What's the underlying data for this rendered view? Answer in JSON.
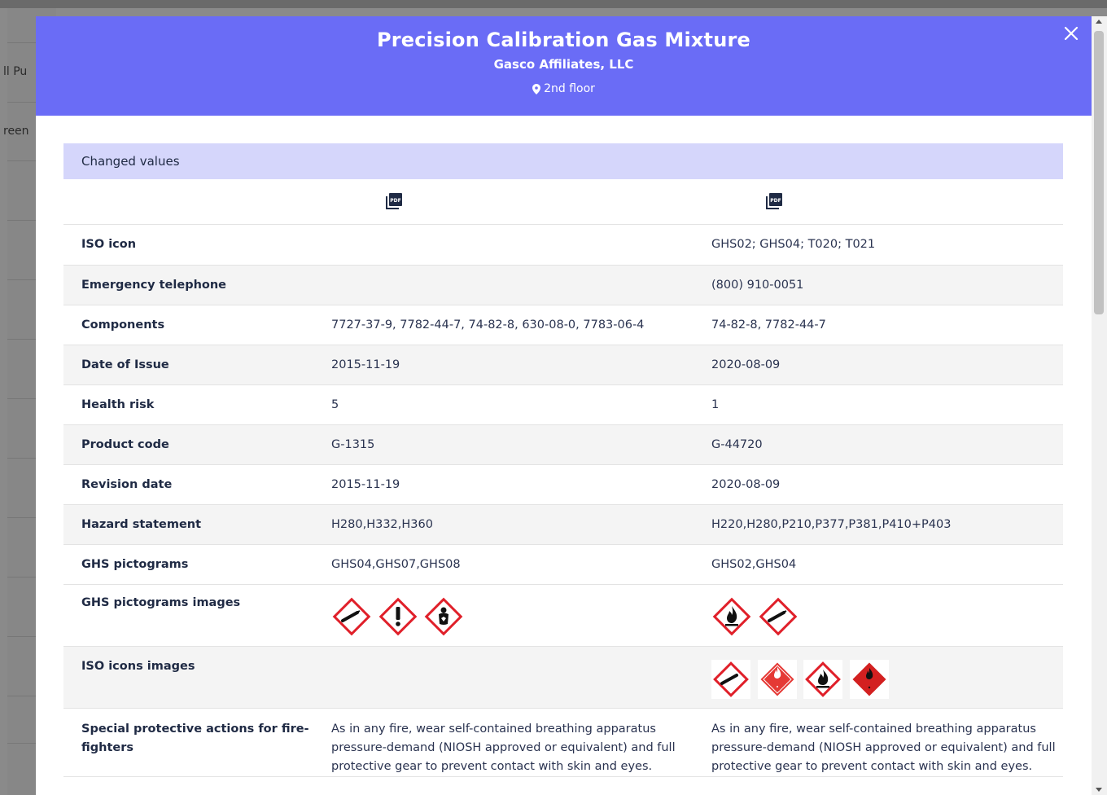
{
  "background": {
    "items": [
      "ll Pu",
      "reen"
    ]
  },
  "header": {
    "title": "Precision Calibration Gas Mixture",
    "supplier": "Gasco Affiliates, LLC",
    "location": "2nd floor"
  },
  "section_title": "Changed values",
  "rows": [
    {
      "label": "ISO icon",
      "old": "",
      "new": "GHS02; GHS04; T020; T021"
    },
    {
      "label": "Emergency telephone",
      "old": "",
      "new": "(800) 910-0051"
    },
    {
      "label": "Components",
      "old": "7727-37-9, 7782-44-7, 74-82-8, 630-08-0, 7783-06-4",
      "new": "74-82-8, 7782-44-7"
    },
    {
      "label": "Date of Issue",
      "old": "2015-11-19",
      "new": "2020-08-09"
    },
    {
      "label": "Health risk",
      "old": "5",
      "new": "1"
    },
    {
      "label": "Product code",
      "old": "G-1315",
      "new": "G-44720"
    },
    {
      "label": "Revision date",
      "old": "2015-11-19",
      "new": "2020-08-09"
    },
    {
      "label": "Hazard statement",
      "old": "H280,H332,H360",
      "new": "H220,H280,P210,P377,P381,P410+P403"
    },
    {
      "label": "GHS pictograms",
      "old": "GHS04,GHS07,GHS08",
      "new": "GHS02,GHS04"
    }
  ],
  "pictograms_row": {
    "label": "GHS pictograms images",
    "old": [
      "gas-cylinder-icon",
      "exclamation-icon",
      "health-hazard-icon"
    ],
    "new": [
      "flame-icon",
      "gas-cylinder-icon"
    ]
  },
  "iso_images_row": {
    "label": "ISO icons images",
    "old": [],
    "new": [
      "gas-cylinder-icon",
      "flammable-gas-label-icon",
      "flame-icon",
      "flammable-label-icon"
    ]
  },
  "firefighter_row": {
    "label": "Special protective actions for fire-fighters",
    "old": "As in any fire, wear self-contained breathing apparatus pressure-demand (NIOSH approved or equivalent) and full protective gear to prevent contact with skin and eyes.",
    "new": "As in any fire, wear self-contained breathing apparatus pressure-demand (NIOSH approved or equivalent) and full protective gear to prevent contact with skin and eyes."
  },
  "colors": {
    "header_bg": "#6a6cf6",
    "section_bg": "#d5d6fb",
    "ghs_red": "#e0202a"
  }
}
